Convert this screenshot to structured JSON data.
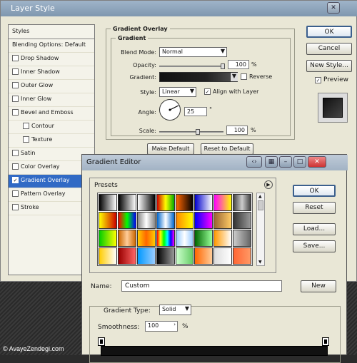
{
  "layer_style": {
    "title": "Layer Style",
    "styles_header": "Styles",
    "items": [
      {
        "label": "Blending Options: Default",
        "check": false,
        "indent": false,
        "selected": false,
        "has_cb": false
      },
      {
        "label": "Drop Shadow",
        "check": false,
        "indent": false,
        "selected": false,
        "has_cb": true
      },
      {
        "label": "Inner Shadow",
        "check": false,
        "indent": false,
        "selected": false,
        "has_cb": true
      },
      {
        "label": "Outer Glow",
        "check": false,
        "indent": false,
        "selected": false,
        "has_cb": true
      },
      {
        "label": "Inner Glow",
        "check": false,
        "indent": false,
        "selected": false,
        "has_cb": true
      },
      {
        "label": "Bevel and Emboss",
        "check": false,
        "indent": false,
        "selected": false,
        "has_cb": true
      },
      {
        "label": "Contour",
        "check": false,
        "indent": true,
        "selected": false,
        "has_cb": true
      },
      {
        "label": "Texture",
        "check": false,
        "indent": true,
        "selected": false,
        "has_cb": true
      },
      {
        "label": "Satin",
        "check": false,
        "indent": false,
        "selected": false,
        "has_cb": true
      },
      {
        "label": "Color Overlay",
        "check": false,
        "indent": false,
        "selected": false,
        "has_cb": true
      },
      {
        "label": "Gradient Overlay",
        "check": true,
        "indent": false,
        "selected": true,
        "has_cb": true
      },
      {
        "label": "Pattern Overlay",
        "check": false,
        "indent": false,
        "selected": false,
        "has_cb": true
      },
      {
        "label": "Stroke",
        "check": false,
        "indent": false,
        "selected": false,
        "has_cb": true
      }
    ],
    "group_title": "Gradient Overlay",
    "sub_title": "Gradient",
    "blend_mode_label": "Blend Mode:",
    "blend_mode": "Normal",
    "opacity_label": "Opacity:",
    "opacity": "100",
    "opacity_unit": "%",
    "opacity_level": 1.0,
    "gradient_label": "Gradient:",
    "reverse_label": "Reverse",
    "style_label": "Style:",
    "style": "Linear",
    "align_label": "Align with Layer",
    "angle_label": "Angle:",
    "angle": "25",
    "angle_unit": "°",
    "scale_label": "Scale:",
    "scale": "100",
    "scale_unit": "%",
    "make_default": "Make Default",
    "reset_default": "Reset to Default",
    "ok": "OK",
    "cancel": "Cancel",
    "new_style": "New Style...",
    "preview": "Preview"
  },
  "gradient_editor": {
    "title": "Gradient Editor",
    "presets_label": "Presets",
    "ok": "OK",
    "reset": "Reset",
    "load": "Load...",
    "save": "Save...",
    "name_label": "Name:",
    "name_value": "Custom",
    "new": "New",
    "gradient_type_label": "Gradient Type:",
    "gradient_type": "Solid",
    "smoothness_label": "Smoothness:",
    "smoothness": "100",
    "smoothness_unit": "%",
    "swatches": [
      "linear-gradient(90deg,#000,#fff)",
      "linear-gradient(90deg,#000,#fff0)",
      "linear-gradient(90deg,#fff,#000)",
      "linear-gradient(90deg,#c00,#ff0,#0a0)",
      "linear-gradient(90deg,#f60,#000)",
      "linear-gradient(90deg,#00c,#fff)",
      "linear-gradient(90deg,#f0f,#ff0)",
      "linear-gradient(90deg,#444,#ccc,#444)",
      "linear-gradient(90deg,#ff0,#c00)",
      "linear-gradient(90deg,#f00,#0f0,#00f)",
      "linear-gradient(90deg,#888,#fff,#888)",
      "linear-gradient(90deg,#06c,#fff,#06c)",
      "linear-gradient(90deg,#f80,#ff0)",
      "linear-gradient(90deg,#00f,#f0f)",
      "linear-gradient(90deg,#963,#fc6)",
      "linear-gradient(90deg,#333,#999)",
      "linear-gradient(90deg,#0c0,#ff0)",
      "linear-gradient(90deg,#c60,#fc9,#c60)",
      "linear-gradient(90deg,#fc0,#f60,#fc0)",
      "linear-gradient(90deg,#f00,#ff0,#0f0,#0ff,#00f,#f0f)",
      "linear-gradient(90deg,#9cf,#fff,#9cf)",
      "linear-gradient(90deg,#060,#9f9)",
      "linear-gradient(90deg,#f90,#fff)",
      "linear-gradient(90deg,#ccc,#666)",
      "linear-gradient(90deg,#fc0,#fff)",
      "linear-gradient(90deg,#900,#f66)",
      "linear-gradient(90deg,#09f,#9cf)",
      "linear-gradient(90deg,#000,#999)",
      "linear-gradient(90deg,#cfc,#6c6)",
      "linear-gradient(90deg,#f60,#fc9)",
      "linear-gradient(90deg,#ddd,#fff)",
      "linear-gradient(90deg,#f63,#f96)"
    ]
  },
  "watermark": "© AvayeZendegi.com"
}
